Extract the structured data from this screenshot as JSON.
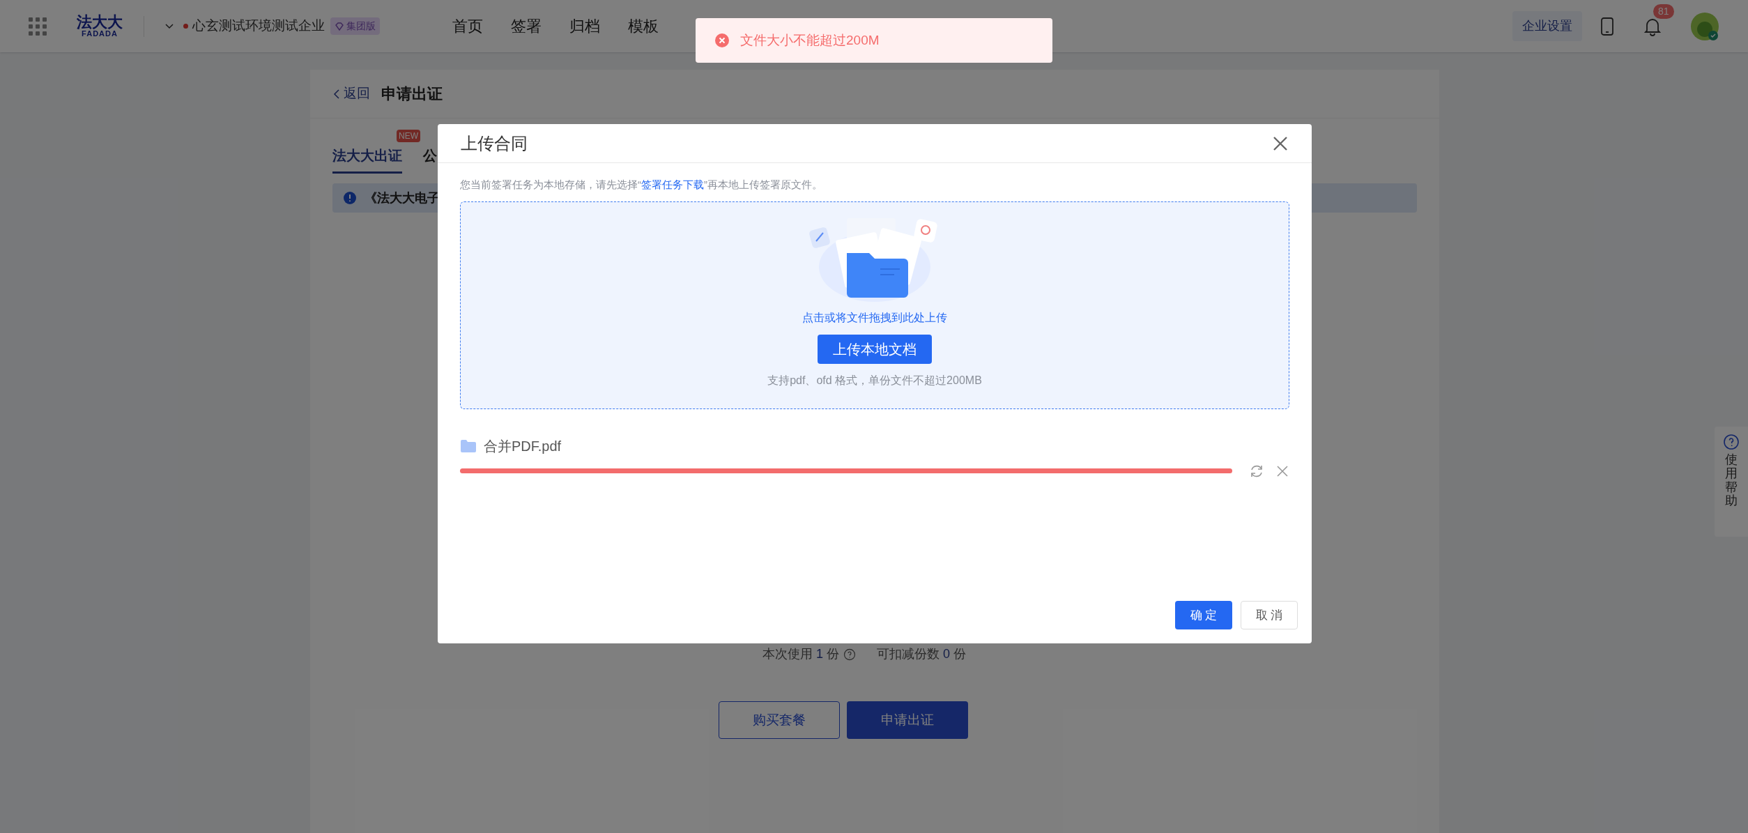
{
  "header": {
    "logo": {
      "mark": "法大大",
      "sub": "FADADA"
    },
    "company": "心玄测试环境测试企业",
    "edition": "集团版",
    "nav": [
      {
        "label": "首页",
        "selected": false
      },
      {
        "label": "签署",
        "selected": false
      },
      {
        "label": "归档",
        "selected": false
      },
      {
        "label": "模板",
        "selected": false
      }
    ],
    "settings": "企业设置",
    "notifications": "81"
  },
  "toast": {
    "kind": "error",
    "message": "文件大小不能超过200M"
  },
  "page": {
    "back": "返回",
    "title": "申请出证",
    "tabs": [
      {
        "label": "法大大出证",
        "selected": true,
        "badge": "NEW"
      },
      {
        "label": "公",
        "selected": false
      }
    ],
    "notice": "《法大大电子",
    "usage": {
      "label": "本次使用",
      "used": "1",
      "unit": "份",
      "remaining_label": "可扣减份数",
      "remaining": "0",
      "remaining_unit": "份"
    },
    "buttons": [
      {
        "label": "购买套餐",
        "kind": "secondary"
      },
      {
        "label": "申请出证",
        "kind": "primary"
      }
    ]
  },
  "help": {
    "label": "使用帮助"
  },
  "dialog": {
    "title": "上传合同",
    "hint": "您当前签署任务为本地存储，请先选择“**签署任务下载**”再本地上传签署原文件。",
    "dropzone": {
      "prompt": "点击或将文件拖拽到此处上传",
      "button": "上传本地文档",
      "note": "支持pdf、ofd 格式，单份文件不超过200MB"
    },
    "files": [
      {
        "name": "合并PDF.pdf",
        "failed": true,
        "level": 1
      }
    ],
    "buttons": [
      {
        "label": "确 定",
        "kind": "primary"
      },
      {
        "label": "取 消",
        "kind": "secondary"
      }
    ]
  }
}
